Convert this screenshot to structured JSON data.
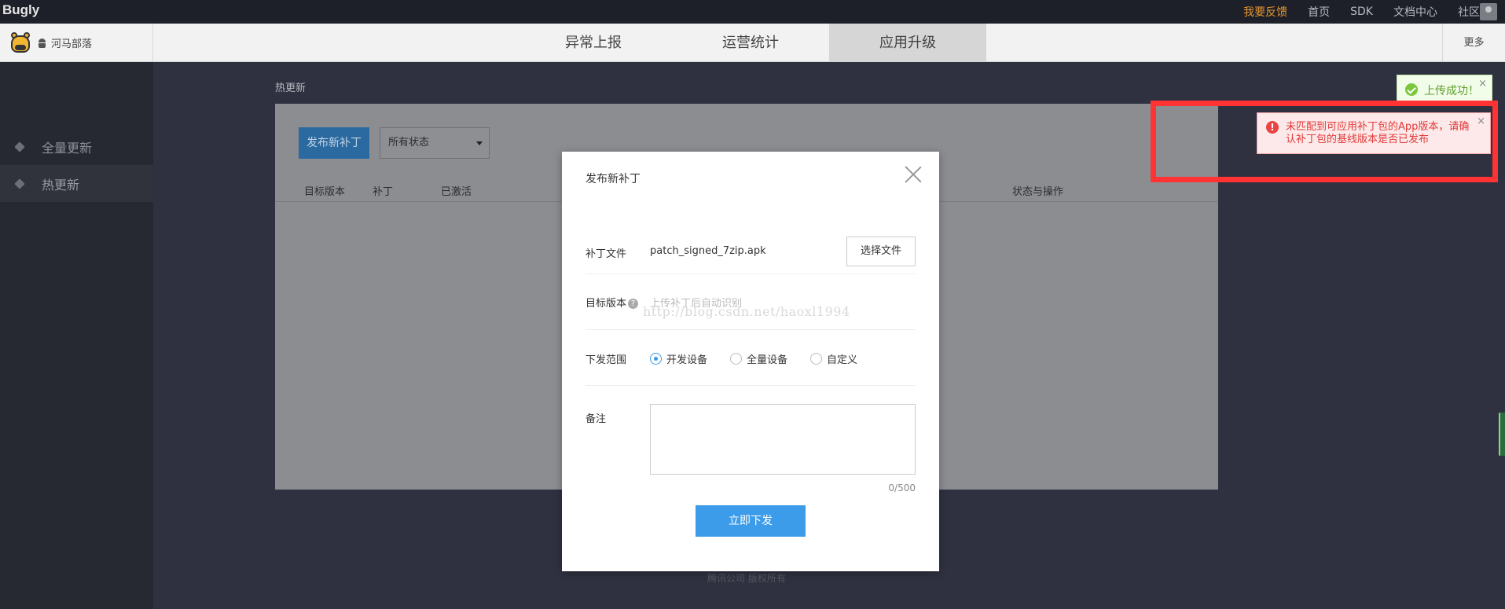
{
  "topbar": {
    "brand": "Bugly",
    "links": [
      "我要反馈",
      "首页",
      "SDK",
      "文档中心",
      "社区"
    ]
  },
  "navbar": {
    "app_name": "河马部落",
    "tabs": [
      "异常上报",
      "运营统计",
      "应用升级"
    ],
    "active_tab": "应用升级",
    "more": "更多"
  },
  "sidebar": {
    "items": [
      "全量更新",
      "热更新"
    ],
    "active": "热更新"
  },
  "main": {
    "title": "热更新",
    "publish_button": "发布新补丁",
    "status_select": "所有状态",
    "table_headers": [
      "目标版本",
      "补丁",
      "已激活",
      "状态与操作"
    ],
    "footer": "腾讯公司 版权所有"
  },
  "toasts": {
    "success": "上传成功！",
    "error": "未匹配到可应用补丁包的App版本，请确认补丁包的基线版本是否已发布",
    "close": "×"
  },
  "modal": {
    "title": "发布新补丁",
    "patch_file_label": "补丁文件",
    "patch_file_name": "patch_signed_7zip.apk",
    "choose_file_button": "选择文件",
    "target_version_label": "目标版本",
    "help_glyph": "?",
    "target_version_placeholder": "上传补丁后自动识别",
    "scope_label": "下发范围",
    "scope_options": [
      "开发设备",
      "全量设备",
      "自定义"
    ],
    "scope_selected": "开发设备",
    "remark_label": "备注",
    "remark_counter": "0/500",
    "submit_button": "立即下发"
  },
  "watermark": "http://blog.csdn.net/haoxl1994",
  "colors": {
    "accent": "#3c9cea",
    "error": "#e13b3b",
    "success": "#5f9e2b",
    "feedback": "#e5962e",
    "highlight": "#ff3333"
  }
}
